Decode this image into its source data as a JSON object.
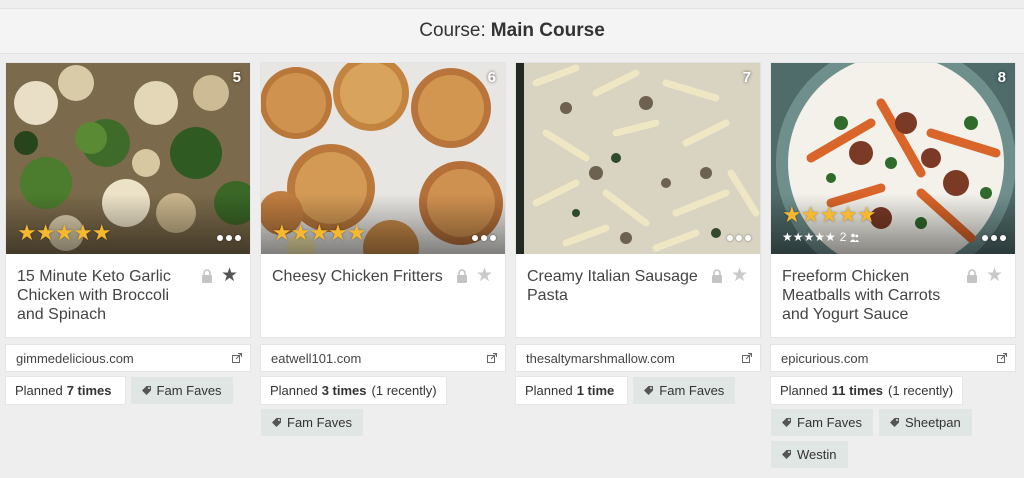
{
  "header": {
    "label": "Course:",
    "value": "Main Course"
  },
  "recipes": [
    {
      "index": "5",
      "title": "15 Minute Keto Garlic Chicken with Broccoli and Spinach",
      "stars": "★★★★★",
      "favorite": true,
      "source": "gimmedelicious.com",
      "planned_prefix": "Planned",
      "planned_count": "7 times",
      "planned_recent": "",
      "tags": [
        "Fam Faves"
      ]
    },
    {
      "index": "6",
      "title": "Cheesy Chicken Fritters",
      "stars": "★★★★★",
      "favorite": false,
      "source": "eatwell101.com",
      "planned_prefix": "Planned",
      "planned_count": "3 times",
      "planned_recent": "(1 recently)",
      "tags": [
        "Fam Faves"
      ]
    },
    {
      "index": "7",
      "title": "Creamy Italian Sausage Pasta",
      "stars": "",
      "favorite": false,
      "source": "thesaltymarshmallow.com",
      "planned_prefix": "Planned",
      "planned_count": "1 time",
      "planned_recent": "",
      "tags": [
        "Fam Faves"
      ]
    },
    {
      "index": "8",
      "title": "Freeform Chicken Meatballs with Carrots and Yogurt Sauce",
      "stars": "★★★★★",
      "community_stars": "★★★★★",
      "community_count": "2",
      "favorite": false,
      "source": "epicurious.com",
      "planned_prefix": "Planned",
      "planned_count": "11 times",
      "planned_recent": "(1 recently)",
      "tags": [
        "Fam Faves",
        "Sheetpan",
        "Westin"
      ]
    }
  ],
  "icons": {
    "lock": "lock-icon",
    "favorite": "star-icon",
    "external": "external-link-icon",
    "tag": "tag-icon",
    "more": "more-dots-icon",
    "people": "people-icon"
  },
  "colors": {
    "rating_star": "#f5b82e",
    "tag_bg": "#dfe6e3",
    "favorite_on": "#555555",
    "favorite_off": "#c9c9c9"
  }
}
